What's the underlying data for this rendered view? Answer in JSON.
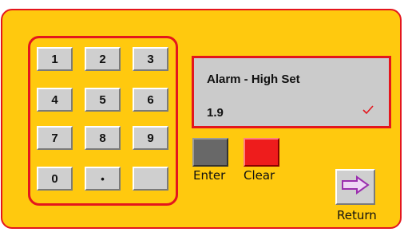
{
  "keypad": {
    "keys": [
      "1",
      "2",
      "3",
      "4",
      "5",
      "6",
      "7",
      "8",
      "9",
      "0",
      "•",
      ""
    ]
  },
  "display": {
    "title": "Alarm - High Set",
    "value": "1.9",
    "status_icon": "check-icon"
  },
  "controls": {
    "enter_label": "Enter",
    "clear_label": "Clear",
    "return_label": "Return"
  },
  "colors": {
    "background": "#ffc90e",
    "border_red": "#e4161d",
    "clear_button": "#ee1c1c",
    "enter_button": "#686868",
    "arrow_icon": "#9b2fae"
  }
}
